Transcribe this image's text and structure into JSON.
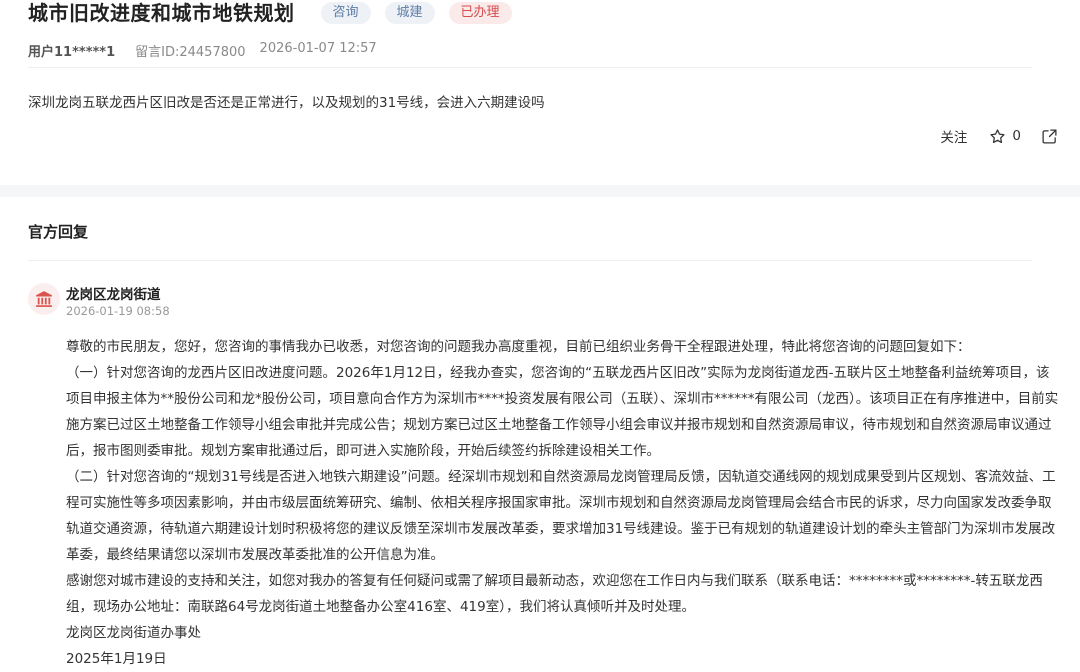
{
  "header": {
    "title": "城市旧改进度和城市地铁规划",
    "tags": [
      "咨询",
      "城建",
      "已办理"
    ],
    "user": "用户11*****1",
    "message_id": "留言ID:24457800",
    "datetime": "2026-01-07 12:57"
  },
  "question": "深圳龙岗五联龙西片区旧改是否还是正常进行，以及规划的31号线，会进入六期建设吗",
  "actions": {
    "follow": "关注",
    "star_count": "0",
    "star_icon": "star-outline-icon",
    "share_icon": "share-icon"
  },
  "reply": {
    "section_title": "官方回复",
    "org_name": "龙岗区龙岗街道",
    "time": "2026-01-19 08:58",
    "avatar_icon": "government-building-icon",
    "paragraphs": [
      "尊敬的市民朋友，您好，您咨询的事情我办已收悉，对您咨询的问题我办高度重视，目前已组织业务骨干全程跟进处理，特此将您咨询的问题回复如下：",
      "（一）针对您咨询的龙西片区旧改进度问题。2026年1月12日，经我办查实，您咨询的“五联龙西片区旧改”实际为龙岗街道龙西-五联片区土地整备利益统筹项目，该项目申报主体为**股份公司和龙*股份公司，项目意向合作方为深圳市****投资发展有限公司（五联）、深圳市******有限公司（龙西）。该项目正在有序推进中，目前实施方案已过区土地整备工作领导小组会审批并完成公告；规划方案已过区土地整备工作领导小组会审议并报市规划和自然资源局审议，待市规划和自然资源局审议通过后，报市图则委审批。规划方案审批通过后，即可进入实施阶段，开始后续签约拆除建设相关工作。",
      "（二）针对您咨询的“规划31号线是否进入地铁六期建设”问题。经深圳市规划和自然资源局龙岗管理局反馈，因轨道交通线网的规划成果受到片区规划、客流效益、工程可实施性等多项因素影响，并由市级层面统筹研究、编制、依相关程序报国家审批。深圳市规划和自然资源局龙岗管理局会结合市民的诉求，尽力向国家发改委争取轨道交通资源，待轨道六期建设计划时积极将您的建议反馈至深圳市发展改革委，要求增加31号线建设。鉴于已有规划的轨道建设计划的牵头主管部门为深圳市发展改革委，最终结果请您以深圳市发展改革委批准的公开信息为准。",
      "感谢您对城市建设的支持和关注，如您对我办的答复有任何疑问或需了解项目最新动态，欢迎您在工作日内与我们联系（联系电话：********或********-转五联龙西组，现场办公地址：南联路64号龙岗街道土地整备办公室416室、419室），我们将认真倾听并及时处理。",
      "龙岗区龙岗街道办事处",
      "2025年1月19日"
    ]
  }
}
